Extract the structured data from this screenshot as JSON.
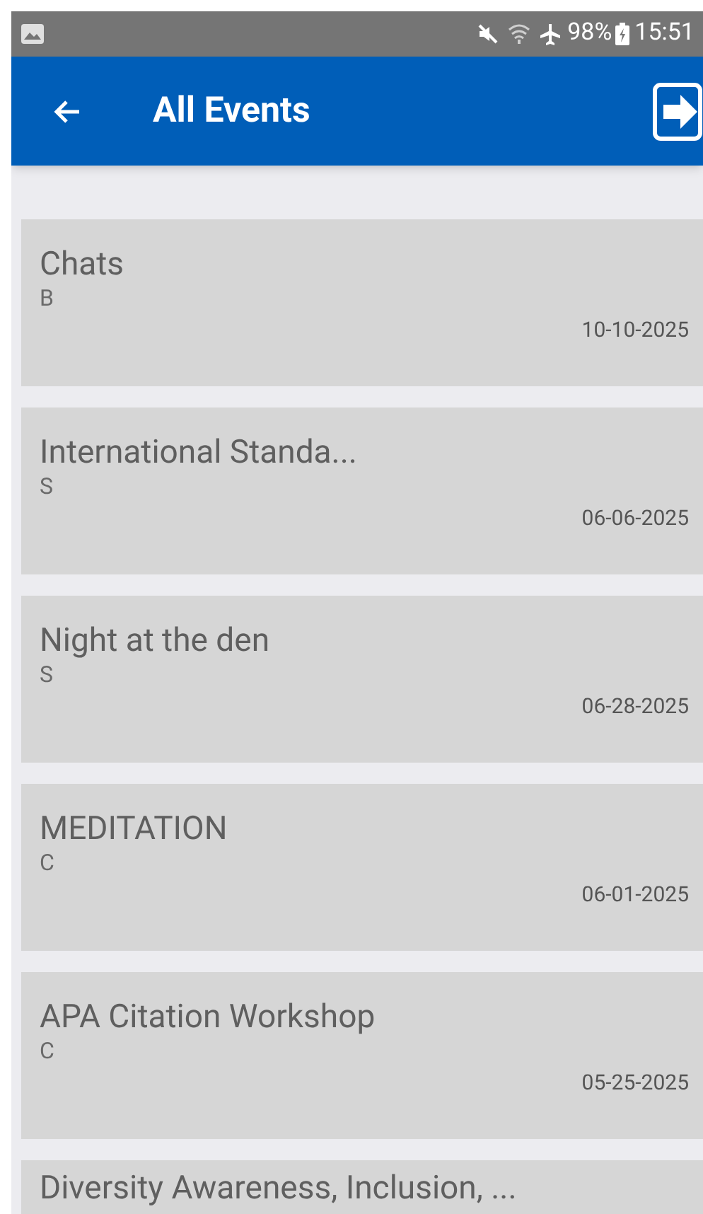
{
  "status_bar": {
    "battery": "98%",
    "time": "15:51"
  },
  "app_bar": {
    "title": "All Events"
  },
  "events": [
    {
      "title": "Chats",
      "subtitle": "B",
      "date": "10-10-2025"
    },
    {
      "title": "International Standa...",
      "subtitle": "S",
      "date": "06-06-2025"
    },
    {
      "title": "Night at the den",
      "subtitle": "S",
      "date": "06-28-2025"
    },
    {
      "title": "MEDITATION",
      "subtitle": "C",
      "date": "06-01-2025"
    },
    {
      "title": "APA Citation Workshop",
      "subtitle": "C",
      "date": "05-25-2025"
    },
    {
      "title": "Diversity Awareness, Inclusion, ..."
    }
  ]
}
